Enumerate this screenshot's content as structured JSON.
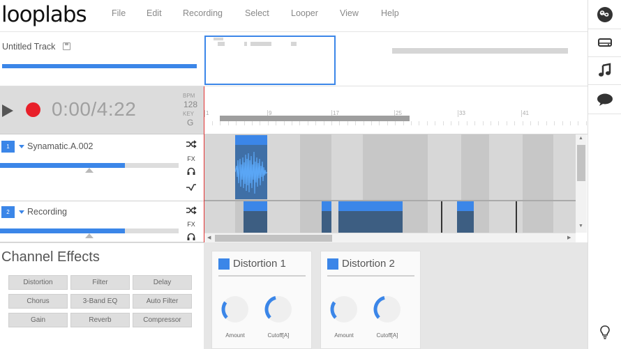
{
  "app": {
    "logo": "looplabs"
  },
  "menu": [
    "File",
    "Edit",
    "Recording",
    "Select",
    "Looper",
    "View",
    "Help"
  ],
  "sidebar_right": {
    "icons": [
      "infinity-icon",
      "drive-icon",
      "music-note-icon",
      "chat-bubble-icon"
    ],
    "bottom_icon": "lightbulb-icon"
  },
  "track_info": {
    "title": "Untitled Track",
    "progress": 1.0
  },
  "transport": {
    "time": "0:00/4:22",
    "bpm_label": "BPM",
    "bpm_value": "128",
    "key_label": "KEY",
    "key_value": "G"
  },
  "ruler": {
    "labels": [
      "1",
      "9",
      "17",
      "25",
      "33",
      "41"
    ]
  },
  "tracks": [
    {
      "number": "1",
      "name": "Synamatic.A.002",
      "volume": 0.7,
      "icons": [
        "shuffle-icon",
        "FX",
        "headphones-icon",
        "automation-icon"
      ]
    },
    {
      "number": "2",
      "name": "Recording",
      "volume": 0.7,
      "icons": [
        "shuffle-icon",
        "FX",
        "headphones-icon"
      ]
    }
  ],
  "channel_effects": {
    "title": "Channel Effects",
    "buttons": [
      "Distortion",
      "Filter",
      "Delay",
      "Chorus",
      "3-Band EQ",
      "Auto Filter",
      "Gain",
      "Reverb",
      "Compressor"
    ]
  },
  "effect_rack": [
    {
      "title": "Distortion 1",
      "knobs": [
        {
          "label": "Amount",
          "value": 0.3
        },
        {
          "label": "Cutoff[A]",
          "value": 0.45
        }
      ]
    },
    {
      "title": "Distortion 2",
      "knobs": [
        {
          "label": "Amount",
          "value": 0.3
        },
        {
          "label": "Cutoff[A]",
          "value": 0.45
        }
      ]
    }
  ],
  "colors": {
    "accent": "#3b86e8",
    "record": "#e8202a",
    "clip_body": "#3d5e82"
  }
}
